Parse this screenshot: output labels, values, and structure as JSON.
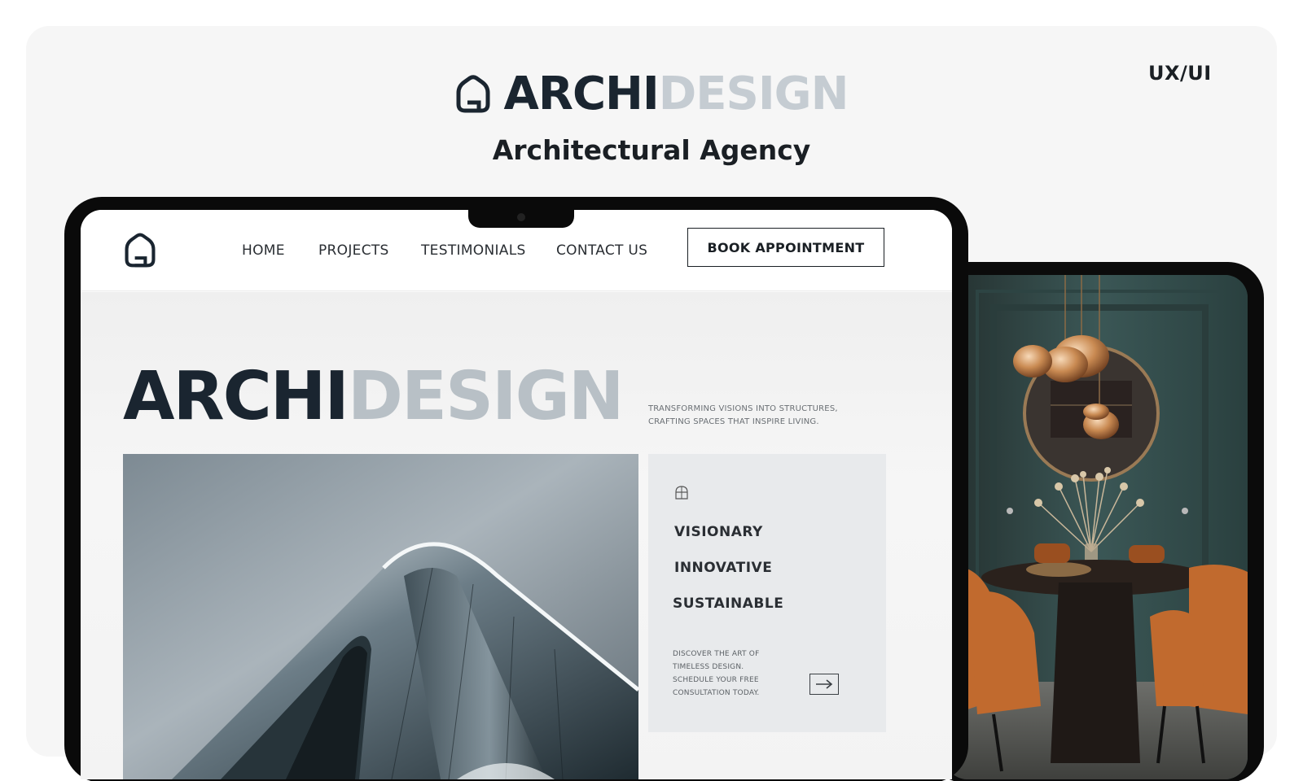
{
  "header": {
    "tag": "UX/UI",
    "brand_dark": "ARCHI",
    "brand_light": "DESIGN",
    "subtitle": "Architectural Agency"
  },
  "nav": {
    "items": [
      "HOME",
      "PROJECTS",
      "TESTIMONIALS",
      "CONTACT US"
    ],
    "cta": "BOOK APPOINTMENT"
  },
  "hero": {
    "title_dark": "ARCHI",
    "title_light": "DESIGN",
    "tagline": "TRANSFORMING VISIONS INTO STRUCTURES, CRAFTING SPACES THAT INSPIRE LIVING.",
    "values": [
      "VISIONARY",
      "INNOVATIVE",
      "SUSTAINABLE"
    ],
    "cta_text": "DISCOVER THE ART OF TIMELESS DESIGN. SCHEDULE YOUR FREE CONSULTATION TODAY."
  },
  "icons": {
    "logo": "house-outline-icon",
    "panel": "dome-icon",
    "arrow": "arrow-right-icon"
  },
  "colors": {
    "dark": "#1a2530",
    "light": "#c5ccd2",
    "panel": "#e8eaec",
    "accent": "#d9893f"
  }
}
